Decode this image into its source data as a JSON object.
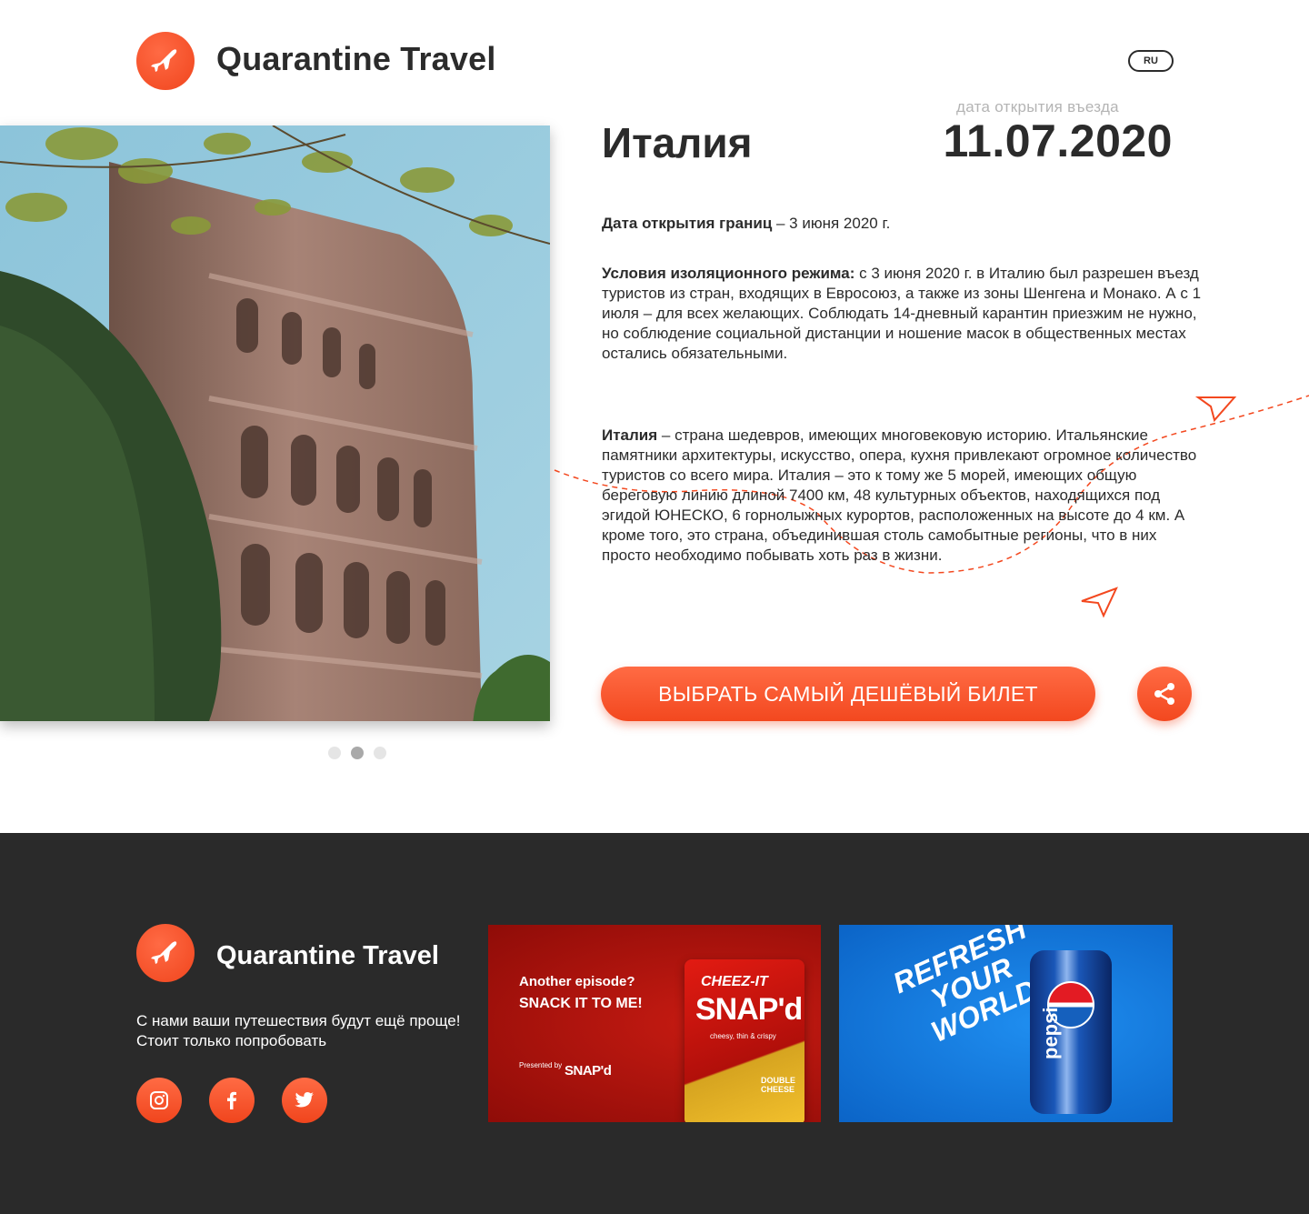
{
  "header": {
    "brand": "Quarantine Travel",
    "lang": "RU"
  },
  "country": {
    "name": "Италия",
    "entry_caption": "дата открытия въезда",
    "entry_date": "11.07.2020"
  },
  "info": {
    "border_label": "Дата открытия границ",
    "border_value": " – 3 июня 2020 г.",
    "conditions_label": "Условия изоляционного режима:",
    "conditions_value": " с 3 июня 2020 г. в Италию был разрешен въезд туристов из стран, входящих в Евросоюз, а также из зоны Шенгена и Монако. А с 1 июля – для всех желающих. Соблюдать 14-дневный карантин приезжим не нужно, но соблюдение социальной дистанции и ношение масок в общественных местах остались обязательными.",
    "about_label": "Италия",
    "about_value": " – страна шедевров, имеющих многовековую историю. Итальянские памятники архитектуры, искусство, опера, кухня привлекают огромное количество туристов со всего мира. Италия – это к тому же 5 морей, имеющих общую береговую линию длиной 7400 км, 48 культурных объектов, находящихся под эгидой ЮНЕСКО, 6 горнолыжных курортов, расположенных на высоте до 4 км. А кроме того, это страна, объединившая столь самобытные регионы, что в них просто необходимо побывать хоть раз в жизни."
  },
  "carousel": {
    "slides": 3,
    "active_index": 1
  },
  "actions": {
    "cta_label": "ВЫБРАТЬ САМЫЙ ДЕШЁВЫЙ БИЛЕТ",
    "share_icon": "share-icon"
  },
  "footer": {
    "brand": "Quarantine Travel",
    "tagline": "С нами ваши путешествия будут ещё проще! Стоит только попробовать",
    "social": [
      "instagram-icon",
      "facebook-icon",
      "twitter-icon"
    ]
  },
  "ads": {
    "cheezit": {
      "line1": "Another episode?",
      "line2": "SNACK IT TO ME!",
      "presented": "Presented by",
      "brand_small": "SNAP'd",
      "bag_brand": "CHEEZ-IT",
      "bag_product": "SNAP'd",
      "bag_flavor_text": "cheesy, thin & crispy",
      "bag_flavor": "DOUBLE CHEESE"
    },
    "pepsi": {
      "slogan": "REFRESH YOUR WORLD",
      "can_word": "pepsi"
    }
  },
  "colors": {
    "accent": "#f3481f",
    "footer_bg": "#2a2a2a",
    "text": "#2b2b2b",
    "muted": "#b4b4b4"
  }
}
